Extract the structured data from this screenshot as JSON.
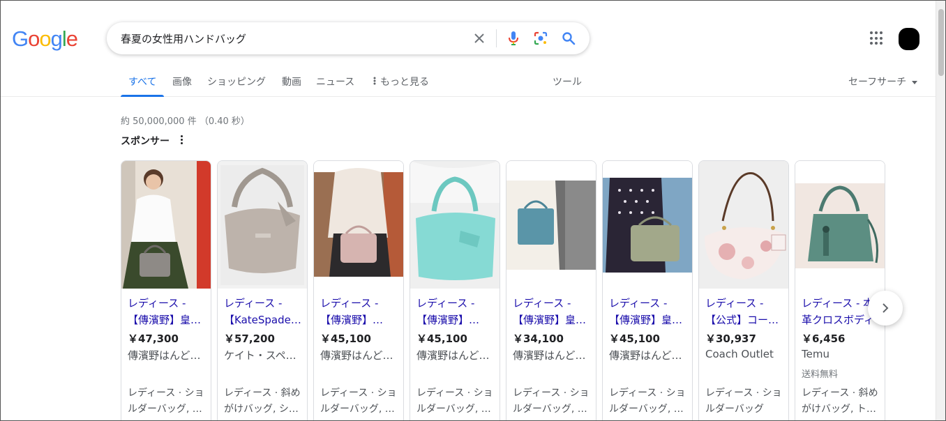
{
  "logo": {
    "text": "Google"
  },
  "search": {
    "query": "春夏の女性用ハンドバッグ"
  },
  "tabs": [
    {
      "label": "すべて"
    },
    {
      "label": "画像"
    },
    {
      "label": "ショッピング"
    },
    {
      "label": "動画"
    },
    {
      "label": "ニュース"
    },
    {
      "label": "もっと見る"
    }
  ],
  "tools_label": "ツール",
  "safe_search_label": "セーフサーチ",
  "stats": "約 50,000,000 件 （0.40 秒）",
  "sponsored_label": "スポンサー",
  "products": [
    {
      "title1": "レディース -",
      "title2": "【傳濱野】皇…",
      "price": "￥47,300",
      "seller": "傳濱野はんど…",
      "shipping": "",
      "cat1": "レディース · ショ",
      "cat2": "ルダーバッグ, …"
    },
    {
      "title1": "レディース -",
      "title2": "【KateSpade…",
      "price": "￥57,200",
      "seller": "ケイト・スペ…",
      "shipping": "",
      "cat1": "レディース · 斜め",
      "cat2": "がけバッグ, シ…"
    },
    {
      "title1": "レディース -",
      "title2": "【傳濱野】…",
      "price": "￥45,100",
      "seller": "傳濱野はんど…",
      "shipping": "",
      "cat1": "レディース · ショ",
      "cat2": "ルダーバッグ, …"
    },
    {
      "title1": "レディース -",
      "title2": "【傳濱野】…",
      "price": "￥45,100",
      "seller": "傳濱野はんど…",
      "shipping": "",
      "cat1": "レディース · ショ",
      "cat2": "ルダーバッグ, …"
    },
    {
      "title1": "レディース -",
      "title2": "【傳濱野】皇…",
      "price": "￥34,100",
      "seller": "傳濱野はんど…",
      "shipping": "",
      "cat1": "レディース · ショ",
      "cat2": "ルダーバッグ, …"
    },
    {
      "title1": "レディース -",
      "title2": "【傳濱野】皇…",
      "price": "￥45,100",
      "seller": "傳濱野はんど…",
      "shipping": "",
      "cat1": "レディース · ショ",
      "cat2": "ルダーバッグ, …"
    },
    {
      "title1": "レディース -",
      "title2": "【公式】コー…",
      "price": "￥30,937",
      "seller": "Coach Outlet",
      "shipping": "",
      "cat1": "レディース · ショ",
      "cat2": "ルダーバッグ"
    },
    {
      "title1": "レディース - 本",
      "title2": "革クロスボディ",
      "price": "￥6,456",
      "seller": "Temu",
      "shipping": "送料無料",
      "cat1": "レディース · 斜め",
      "cat2": "がけバッグ, ト…"
    }
  ]
}
